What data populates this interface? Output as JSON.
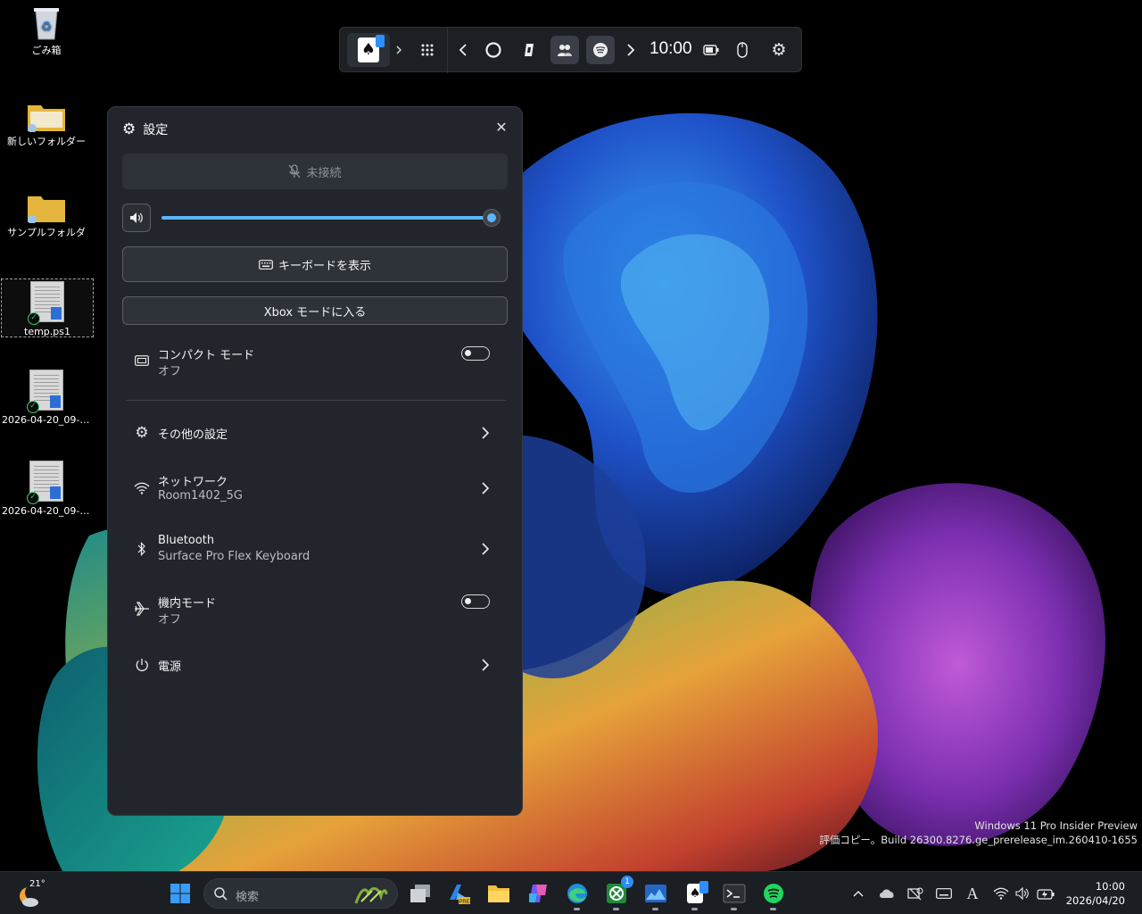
{
  "desktop": {
    "icons": [
      {
        "label": "ごみ箱",
        "kind": "recycle-bin"
      },
      {
        "label": "新しいフォルダー",
        "kind": "folder"
      },
      {
        "label": "サンプルフォルダ",
        "kind": "folder"
      },
      {
        "label": "temp.ps1",
        "kind": "script-file",
        "selected": true
      },
      {
        "label": "2026-04-20_09-5...",
        "kind": "script-file"
      },
      {
        "label": "2026-04-20_09-5...",
        "kind": "script-file"
      }
    ]
  },
  "top_bar": {
    "app_icon": "solitaire-icon",
    "time": "10:00",
    "buttons": [
      "expand-chevron",
      "app-grid",
      "back",
      "edge",
      "copilot",
      "teams-people",
      "spotify",
      "forward",
      "battery",
      "mouse",
      "settings"
    ]
  },
  "settings_panel": {
    "title": "設定",
    "mic_status": "未接続",
    "volume_level": 1.0,
    "keyboard_button": "キーボードを表示",
    "xbox_button": "Xbox モードに入る",
    "compact_mode": {
      "label": "コンパクト モード",
      "value": "オフ",
      "on": false
    },
    "other_settings": {
      "label": "その他の設定"
    },
    "network": {
      "label": "ネットワーク",
      "value": "Room1402_5G"
    },
    "bluetooth": {
      "label": "Bluetooth",
      "value": "Surface Pro Flex Keyboard"
    },
    "airplane_mode": {
      "label": "機内モード",
      "value": "オフ",
      "on": false
    },
    "power": {
      "label": "電源"
    }
  },
  "watermark": {
    "line1": "Windows 11 Pro Insider Preview",
    "line2": "評価コピー。Build 26300.8276.ge_prerelease_im.260410-1655"
  },
  "taskbar": {
    "weather_temp": "21°",
    "search_placeholder": "検索",
    "xbox_badge": "1",
    "clock_time": "10:00",
    "clock_date": "2026/04/20",
    "ime_indicator": "A",
    "accent": "#5db5ff"
  }
}
